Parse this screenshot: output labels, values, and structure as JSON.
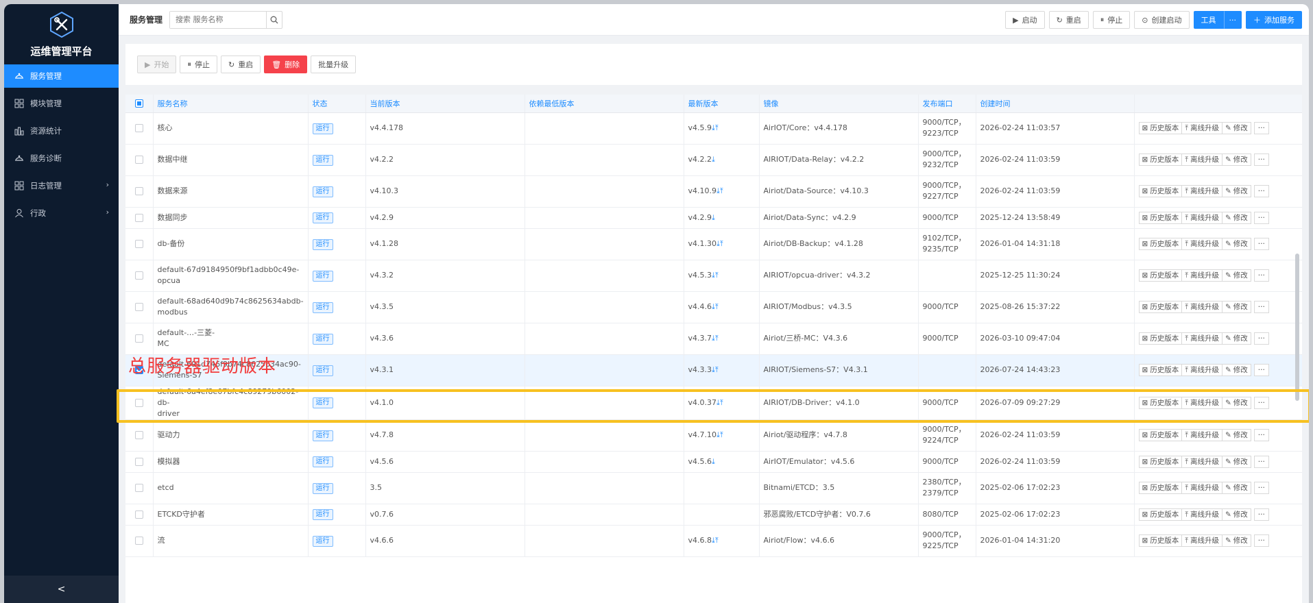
{
  "app": {
    "title": "运维管理平台"
  },
  "sidebar": {
    "items": [
      {
        "label": "服务管理",
        "icon": "service-icon",
        "active": true,
        "arrow": false
      },
      {
        "label": "模块管理",
        "icon": "grid-icon",
        "active": false,
        "arrow": false
      },
      {
        "label": "资源统计",
        "icon": "bar-chart-icon",
        "active": false,
        "arrow": false
      },
      {
        "label": "服务诊断",
        "icon": "service-icon",
        "active": false,
        "arrow": false
      },
      {
        "label": "日志管理",
        "icon": "grid-icon",
        "active": false,
        "arrow": true
      },
      {
        "label": "行政",
        "icon": "user-icon",
        "active": false,
        "arrow": true
      }
    ],
    "collapse_label": "<"
  },
  "header": {
    "title": "服务管理",
    "search_placeholder": "搜索 服务名称",
    "buttons": {
      "start": "启动",
      "restart": "重启",
      "stop": "停止",
      "create_start": "创建启动",
      "tools": "工具",
      "more": "···",
      "add": "添加服务"
    }
  },
  "actions": {
    "start": "开始",
    "stop": "停止",
    "restart": "重启",
    "delete": "删除",
    "batch": "批量升级"
  },
  "table": {
    "columns": [
      "服务名称",
      "状态",
      "当前版本",
      "依赖最低版本",
      "最新版本",
      "镜像",
      "发布端口",
      "创建时间"
    ],
    "op_labels": {
      "history": "历史版本",
      "offline": "离线升级",
      "edit": "修改",
      "more": "···"
    },
    "rows": [
      {
        "name": "核心",
        "status": "运行",
        "current": "v4.4.178",
        "min": "",
        "latest": "v4.5.9",
        "latest_icons": "⤓⤒",
        "image": "AirIOT/Core：v4.4.178",
        "ports": "9000/TCP，\n9223/TCP",
        "created": "2026-02-24 11:03:57",
        "selected": false
      },
      {
        "name": "数据中继",
        "status": "运行",
        "current": "v4.2.2",
        "min": "",
        "latest": "v4.2.2",
        "latest_icons": "⤓",
        "image": "AIRIOT/Data-Relay：v4.2.2",
        "ports": "9000/TCP，\n9232/TCP",
        "created": "2026-02-24 11:03:59",
        "selected": false
      },
      {
        "name": "数据来源",
        "status": "运行",
        "current": "v4.10.3",
        "min": "",
        "latest": "v4.10.9",
        "latest_icons": "⤓⤒",
        "image": "Airiot/Data-Source：v4.10.3",
        "ports": "9000/TCP，\n9227/TCP",
        "created": "2026-02-24 11:03:59",
        "selected": false
      },
      {
        "name": "数据同步",
        "status": "运行",
        "current": "v4.2.9",
        "min": "",
        "latest": "v4.2.9",
        "latest_icons": "⤓",
        "image": "Airiot/Data-Sync：v4.2.9",
        "ports": "9000/TCP",
        "created": "2025-12-24 13:58:49",
        "selected": false
      },
      {
        "name": "db-备份",
        "status": "运行",
        "current": "v4.1.28",
        "min": "",
        "latest": "v4.1.30",
        "latest_icons": "⤓⤒",
        "image": "Airiot/DB-Backup：v4.1.28",
        "ports": "9102/TCP，\n9235/TCP",
        "created": "2026-01-04 14:31:18",
        "selected": false
      },
      {
        "name": "default-67d9184950f9bf1adbb0c49e-\nopcua",
        "status": "运行",
        "current": "v4.3.2",
        "min": "",
        "latest": "v4.5.3",
        "latest_icons": "⤓⤒",
        "image": "AIRIOT/opcua-driver：v4.3.2",
        "ports": "",
        "created": "2025-12-25 11:30:24",
        "selected": false
      },
      {
        "name": "default-68ad640d9b74c8625634abdb-\nmodbus",
        "status": "运行",
        "current": "v4.3.5",
        "min": "",
        "latest": "v4.4.6",
        "latest_icons": "⤓⤒",
        "image": "AIRIOT/Modbus：v4.3.5",
        "ports": "9000/TCP",
        "created": "2025-08-26 15:37:22",
        "selected": false
      },
      {
        "name": "default-…-三菱-\nMC",
        "status": "运行",
        "current": "v4.3.6",
        "min": "",
        "latest": "v4.3.7",
        "latest_icons": "⤓⤒",
        "image": "Airiot/三桥-MC：V4.3.6",
        "ports": "9000/TCP",
        "created": "2026-03-10 09:47:04",
        "selected": false
      },
      {
        "name": "default-691d746f9b74c8625634ac90-\nSiemens-S7",
        "status": "运行",
        "current": "v4.3.1",
        "min": "",
        "latest": "v4.3.3",
        "latest_icons": "⤓⤒",
        "image": "AIRIOT/Siemens-S7：V4.3.1",
        "ports": "",
        "created": "2026-07-24 14:43:23",
        "selected": true
      },
      {
        "name": "default-6a4ef8e07bfc4c89279b6002-db-\ndriver",
        "status": "运行",
        "current": "v4.1.0",
        "min": "",
        "latest": "v4.0.37",
        "latest_icons": "⤓⤒",
        "image": "AIRIOT/DB-Driver：v4.1.0",
        "ports": "9000/TCP",
        "created": "2026-07-09 09:27:29",
        "selected": false
      },
      {
        "name": "驱动力",
        "status": "运行",
        "current": "v4.7.8",
        "min": "",
        "latest": "v4.7.10",
        "latest_icons": "⤓⤒",
        "image": "Airiot/驱动程序：v4.7.8",
        "ports": "9000/TCP，\n9224/TCP",
        "created": "2026-02-24 11:03:59",
        "selected": false
      },
      {
        "name": "模拟器",
        "status": "运行",
        "current": "v4.5.6",
        "min": "",
        "latest": "v4.5.6",
        "latest_icons": "⤓",
        "image": "AirIOT/Emulator：v4.5.6",
        "ports": "9000/TCP",
        "created": "2026-02-24 11:03:59",
        "selected": false
      },
      {
        "name": "etcd",
        "status": "运行",
        "current": "3.5",
        "min": "",
        "latest": "",
        "latest_icons": "",
        "image": "Bitnami/ETCD：3.5",
        "ports": "2380/TCP，\n2379/TCP",
        "created": "2025-02-06 17:02:23",
        "selected": false
      },
      {
        "name": "ETCKD守护者",
        "status": "运行",
        "current": "v0.7.6",
        "min": "",
        "latest": "",
        "latest_icons": "",
        "image": "邪恶腐败/ETCD守护者：V0.7.6",
        "ports": "8080/TCP",
        "created": "2025-02-06 17:02:23",
        "selected": false
      },
      {
        "name": "流",
        "status": "运行",
        "current": "v4.6.6",
        "min": "",
        "latest": "v4.6.8",
        "latest_icons": "⤓⤒",
        "image": "Airiot/Flow：v4.6.6",
        "ports": "9000/TCP，\n9225/TCP",
        "created": "2026-01-04 14:31:20",
        "selected": false
      }
    ]
  },
  "annotation": {
    "label": "总服务器驱动版本",
    "color": "#f23c3c",
    "highlight_color": "#f7c121"
  }
}
